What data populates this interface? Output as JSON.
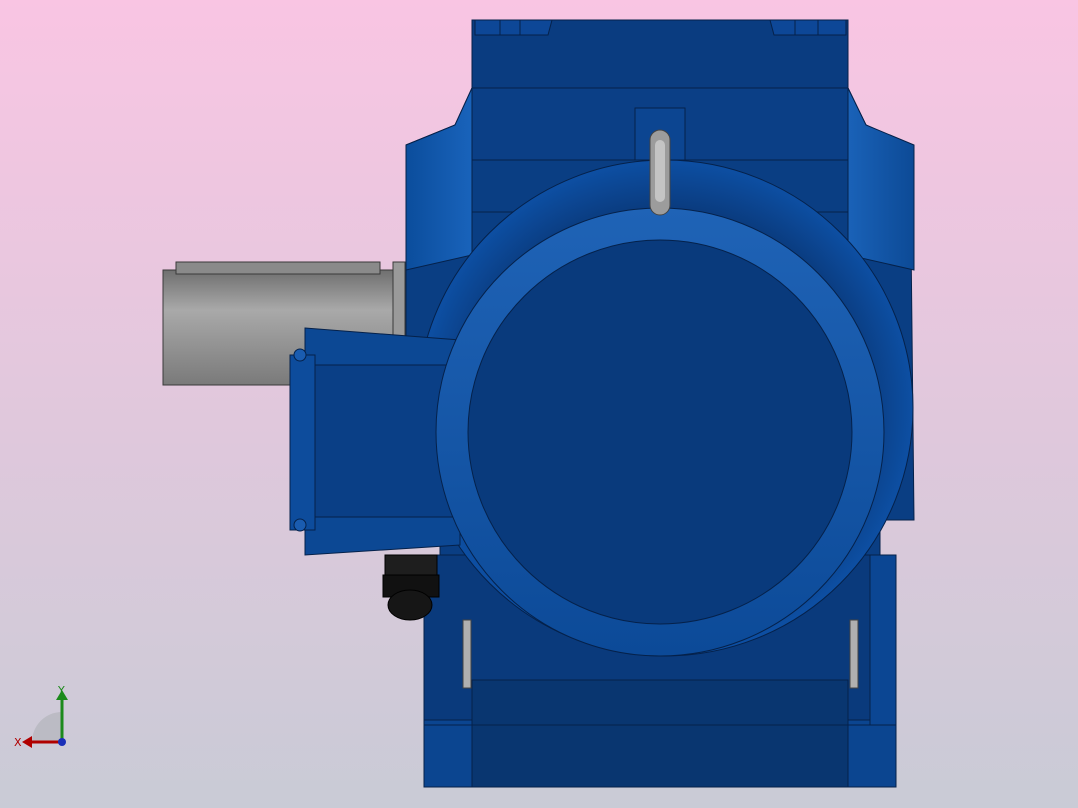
{
  "colors": {
    "background_top": "#f9c5e3",
    "background_bottom": "#c9cbd6",
    "body_dark": "#0a3673",
    "body_mid": "#0b4a97",
    "body_light": "#1a5cb0",
    "outline": "#05214a",
    "shaft_gray": "#8c8c8c",
    "gland_black": "#1a1a1a",
    "axis_x": "#b00000",
    "axis_y": "#1c8a1c",
    "axis_z": "#1a2fb8"
  },
  "viewport": {
    "model": "gear-motor-assembly-front-view"
  },
  "triad": {
    "x_label": "X",
    "y_label": "Y"
  }
}
